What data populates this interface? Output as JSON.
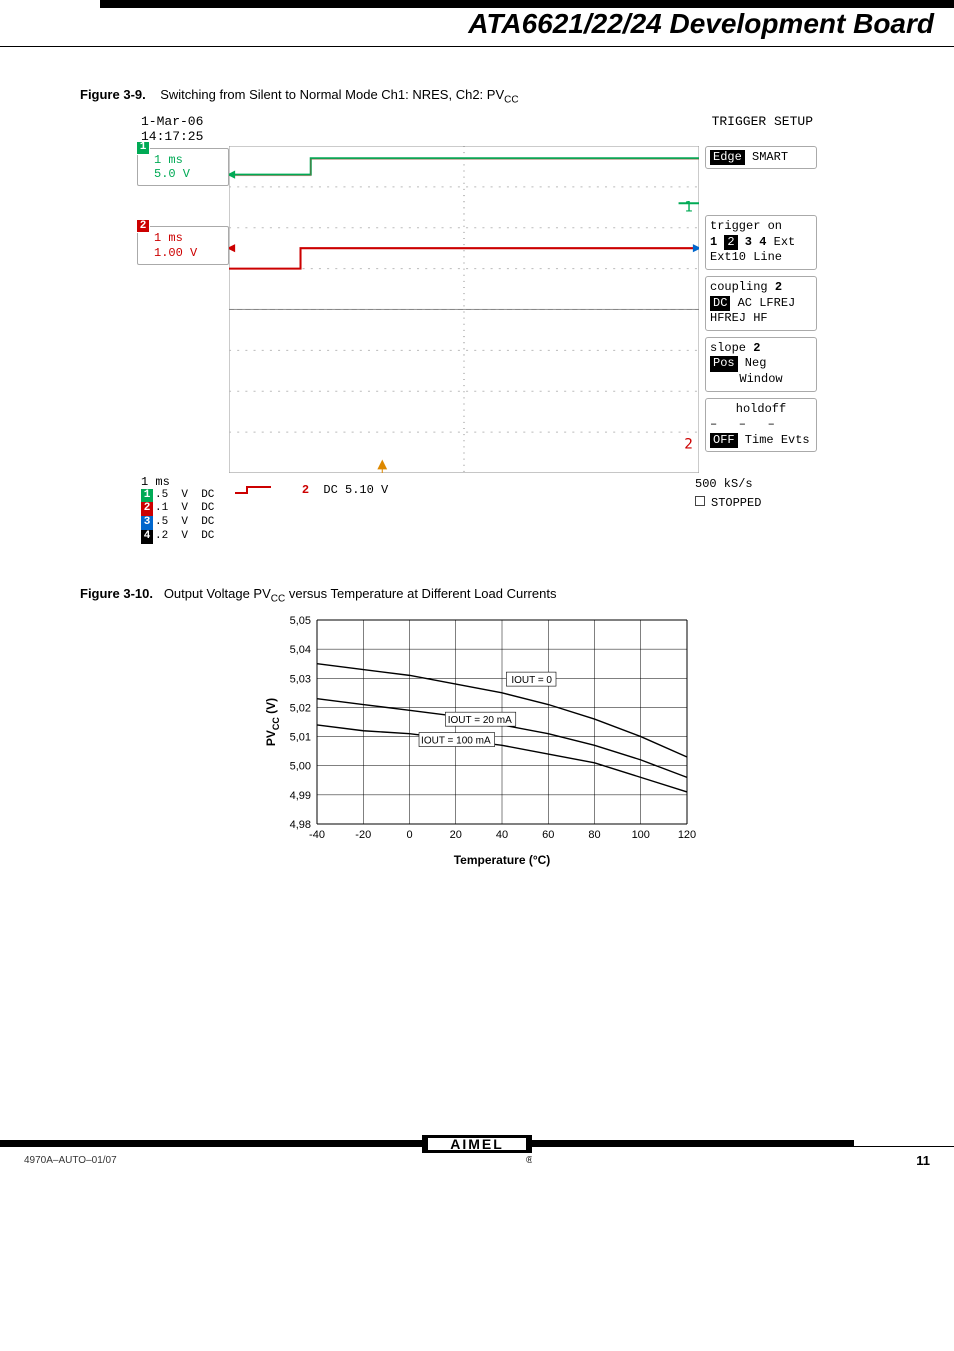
{
  "header": {
    "title": "ATA6621/22/24 Development Board"
  },
  "fig9": {
    "caption_label": "Figure 3-9.",
    "caption_text": "Switching from Silent to Normal Mode Ch1: NRES, Ch2: PV",
    "caption_sub": "CC",
    "timestamp_date": "1-Mar-06",
    "timestamp_time": "14:17:25",
    "right_title": "TRIGGER SETUP",
    "ch1": {
      "timediv": "1 ms",
      "vdiv": "5.0 V"
    },
    "ch2": {
      "timediv": "1 ms",
      "vdiv": "1.00 V"
    },
    "trigger_mode": {
      "hl": "Edge",
      "rest": " SMART"
    },
    "trigger_on": {
      "title": "trigger on",
      "opts": "1 2 3 4 Ext",
      "line2": "Ext10 Line",
      "hl_index": "2"
    },
    "coupling": {
      "title": "coupling",
      "num": "2",
      "opts_hl": "DC",
      "opts_rest": " AC LFREJ",
      "line2": "HFREJ HF"
    },
    "slope": {
      "title": "slope",
      "num": "2",
      "opts_hl": "Pos",
      "opts_rest": "   Neg",
      "line2": "Window"
    },
    "holdoff": {
      "title": "holdoff",
      "hl": "OFF",
      "rest": " Time Evts"
    },
    "timebase": "1 ms",
    "bottom_channels": [
      {
        "n": "1",
        "v": ".5",
        "unit": "V",
        "set": "DC"
      },
      {
        "n": "2",
        "v": ".1",
        "unit": "V",
        "set": "DC"
      },
      {
        "n": "3",
        "v": ".5",
        "unit": "V",
        "set": "DC"
      },
      {
        "n": "4",
        "v": ".2",
        "unit": "V",
        "set": "DC"
      }
    ],
    "measure_label": "2",
    "measure_value": "DC 5.10 V",
    "sample_rate": "500 kS/s",
    "run_state": "STOPPED"
  },
  "fig10": {
    "caption_label": "Figure 3-10.",
    "caption_text": "Output Voltage PV",
    "caption_sub": "CC",
    "caption_text2": " versus Temperature at Different Load Currents",
    "ylabel_main": "PV",
    "ylabel_sub": "CC",
    "ylabel_unit": " (V)",
    "xlabel": "Temperature (°C)",
    "annotations": {
      "a0": "IOUT = 0",
      "a20": "IOUT = 20 mA",
      "a100": "IOUT = 100 mA"
    }
  },
  "chart_data": {
    "type": "line",
    "title": "Output Voltage PVCC versus Temperature at Different Load Currents",
    "xlabel": "Temperature (°C)",
    "ylabel": "PVCC (V)",
    "xlim": [
      -40,
      120
    ],
    "ylim": [
      4.98,
      5.05
    ],
    "x": [
      -40,
      -20,
      0,
      20,
      40,
      60,
      80,
      100,
      120
    ],
    "series": [
      {
        "name": "IOUT = 0",
        "values": [
          5.035,
          5.033,
          5.031,
          5.028,
          5.025,
          5.021,
          5.016,
          5.01,
          5.003
        ]
      },
      {
        "name": "IOUT = 20 mA",
        "values": [
          5.023,
          5.021,
          5.019,
          5.017,
          5.014,
          5.011,
          5.007,
          5.002,
          4.996
        ]
      },
      {
        "name": "IOUT = 100 mA",
        "values": [
          5.014,
          5.012,
          5.011,
          5.009,
          5.007,
          5.004,
          5.001,
          4.996,
          4.991
        ]
      }
    ]
  },
  "footer": {
    "left": "4970A–AUTO–01/07",
    "page": "11",
    "logo_alt": "ATMEL"
  }
}
